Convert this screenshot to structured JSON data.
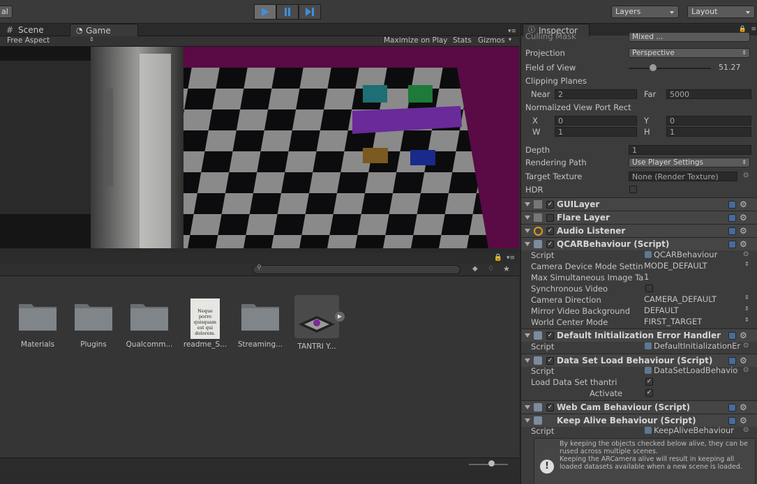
{
  "toolbar": {
    "left_label": "al",
    "layers_label": "Layers",
    "layout_label": "Layout"
  },
  "scene_tabs": {
    "scene": "Scene",
    "game": "Game",
    "aspect": "Free Aspect",
    "maximize": "Maximize on Play",
    "stats": "Stats",
    "gizmos": "Gizmos"
  },
  "project": {
    "assets": [
      {
        "label": "Materials"
      },
      {
        "label": "Plugins"
      },
      {
        "label": "Qualcomm..."
      },
      {
        "label": "readme_S..."
      },
      {
        "label": "Streaming..."
      },
      {
        "label": "TANTRI Y..."
      }
    ],
    "readme_text": "Neque porro quisquam est qui dolorem."
  },
  "inspector": {
    "tab": "Inspector",
    "culling_mask": "Culling Mask",
    "culling_value": "Mixed ...",
    "projection_label": "Projection",
    "projection_value": "Perspective",
    "fov_label": "Field of View",
    "fov_value": "51.27",
    "clipping_label": "Clipping Planes",
    "near_label": "Near",
    "near_value": "2",
    "far_label": "Far",
    "far_value": "5000",
    "viewport_label": "Normalized View Port Rect",
    "x_label": "X",
    "x_value": "0",
    "y_label": "Y",
    "y_value": "0",
    "w_label": "W",
    "w_value": "1",
    "h_label": "H",
    "h_value": "1",
    "depth_label": "Depth",
    "depth_value": "1",
    "rendering_label": "Rendering Path",
    "rendering_value": "Use Player Settings",
    "target_label": "Target Texture",
    "target_value": "None (Render Texture)",
    "hdr_label": "HDR",
    "components": {
      "gui_layer": "GUILayer",
      "flare_layer": "Flare Layer",
      "audio_listener": "Audio Listener",
      "qcar": "QCARBehaviour (Script)",
      "default_init": "Default Initialization Error Handler (S",
      "data_set": "Data Set Load Behaviour (Script)",
      "webcam": "Web Cam Behaviour (Script)",
      "keep_alive": "Keep Alive Behaviour (Script)"
    },
    "qcar_fields": {
      "script_label": "Script",
      "script_value": "QCARBehaviour",
      "cam_mode_label": "Camera Device Mode Settin",
      "cam_mode_value": "MODE_DEFAULT",
      "max_images_label": "Max Simultaneous Image Ta",
      "max_images_value": "1",
      "sync_label": "Synchronous Video",
      "cam_dir_label": "Camera Direction",
      "cam_dir_value": "CAMERA_DEFAULT",
      "mirror_label": "Mirror Video Background",
      "mirror_value": "DEFAULT",
      "world_label": "World Center Mode",
      "world_value": "FIRST_TARGET"
    },
    "default_init_fields": {
      "script_label": "Script",
      "script_value": "DefaultInitializationEri"
    },
    "data_set_fields": {
      "script_label": "Script",
      "script_value": "DataSetLoadBehavio",
      "load_label": "Load Data Set thantri",
      "activate_label": "Activate"
    },
    "keep_alive_fields": {
      "script_label": "Script",
      "script_value": "KeepAliveBehaviour",
      "help_text_1": "By keeping the objects checked below alive, they can be rused across multiple scenes.",
      "help_text_2": "Keeping the ARCamera alive will result in keeping all loaded datasets available when a new scene is loaded."
    }
  },
  "colors": {
    "play_blue": "#3d8fe0",
    "magenta": "#6a0a4a",
    "panel": "#3c3c3c"
  }
}
